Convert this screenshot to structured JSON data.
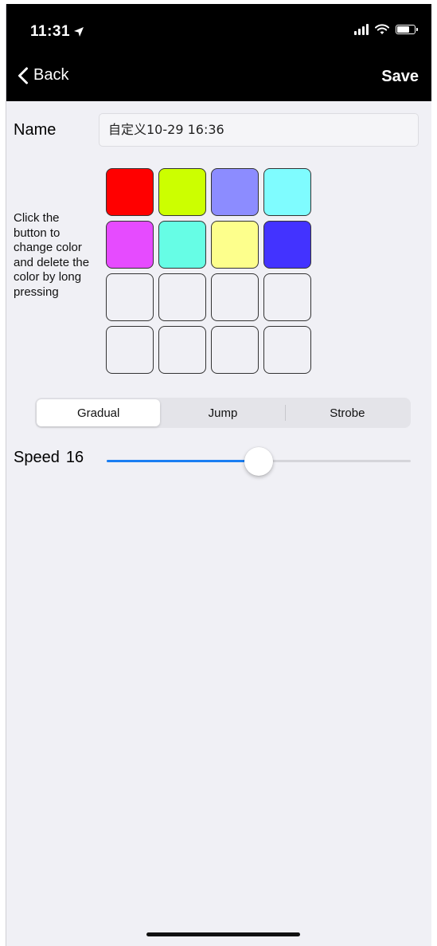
{
  "status_bar": {
    "time": "11:31",
    "icons": [
      "location-arrow-icon",
      "cellular-signal-icon",
      "wifi-icon",
      "battery-icon"
    ],
    "battery_level": 0.7
  },
  "nav": {
    "back_label": "Back",
    "save_label": "Save"
  },
  "form": {
    "name_label": "Name",
    "name_value": "自定义10-29 16:36"
  },
  "hint": {
    "text": "Click the button to change color and delete the color by long pressing"
  },
  "colors": {
    "swatches": [
      "#ff0000",
      "#ccff00",
      "#8c8cff",
      "#7ffcff",
      "#e64bff",
      "#66fde5",
      "#fdff8c",
      "#4333ff",
      "",
      "",
      "",
      "",
      "",
      "",
      "",
      ""
    ],
    "empty_color": "#f0f0f5"
  },
  "mode": {
    "options": [
      "Gradual",
      "Jump",
      "Strobe"
    ],
    "selected_index": 0
  },
  "speed": {
    "label": "Speed",
    "value": "16",
    "fraction": 0.5
  },
  "theme": {
    "accent": "#1a7ef2",
    "nav_background": "#000000",
    "page_background": "#f0f0f5"
  }
}
